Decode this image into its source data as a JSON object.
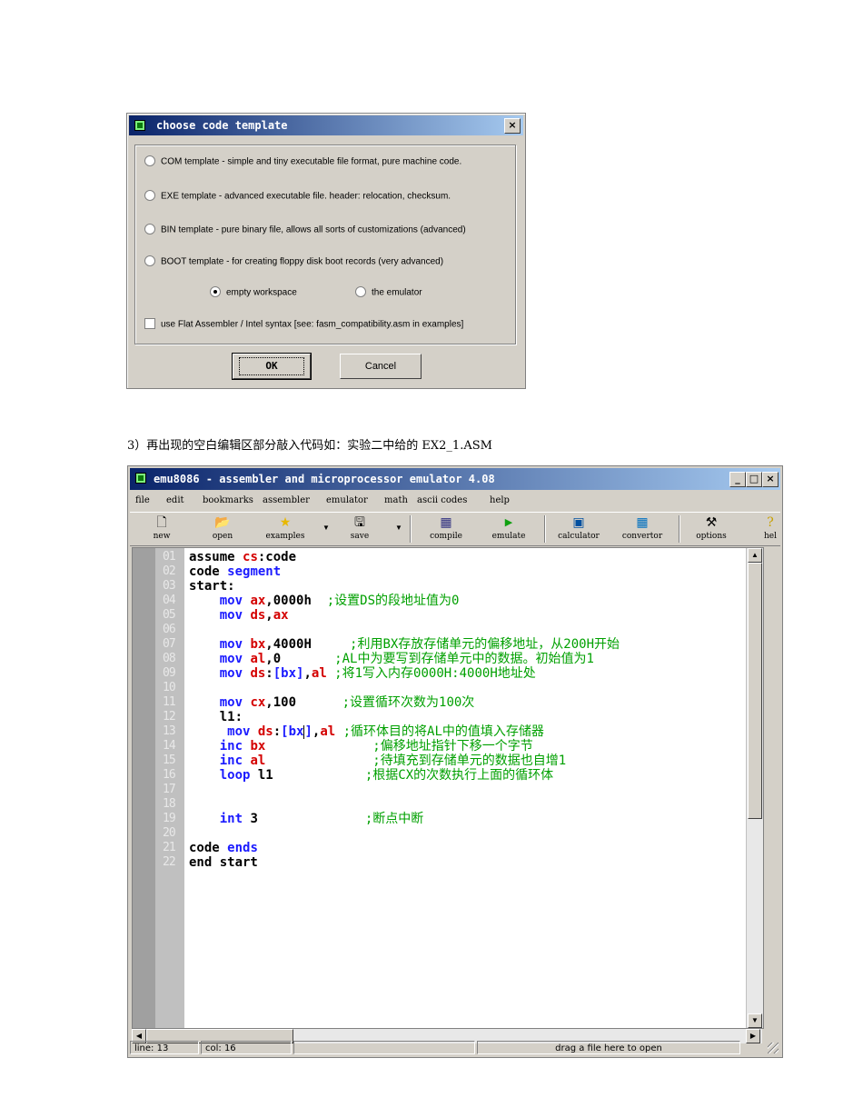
{
  "dialog": {
    "title": "choose code template",
    "close_label": "×",
    "options": [
      "COM template - simple and tiny executable file format, pure machine code.",
      "EXE template - advanced executable file. header: relocation, checksum.",
      "BIN template - pure binary file, allows all sorts of customizations (advanced)",
      "BOOT template - for creating floppy disk boot records (very advanced)"
    ],
    "empty_workspace": "empty workspace",
    "the_emulator": "the emulator",
    "flat_assembler": "use Flat Assembler / Intel syntax   [see: fasm_compatibility.asm in examples]",
    "ok_label": "OK",
    "cancel_label": "Cancel"
  },
  "caption": "3）再出现的空白编辑区部分敲入代码如：实验二中给的 EX2_1.ASM",
  "emu": {
    "title": "emu8086 - assembler and microprocessor emulator 4.08",
    "minimize": "_",
    "maximize": "□",
    "close": "×",
    "menu": [
      "file",
      "edit",
      "bookmarks",
      "assembler",
      "emulator",
      "math",
      "ascii codes",
      "help"
    ],
    "toolbar": {
      "new": "new",
      "open": "open",
      "examples": "examples",
      "save": "save",
      "compile": "compile",
      "emulate": "emulate",
      "calculator": "calculator",
      "convertor": "convertor",
      "options": "options",
      "help": "hel"
    },
    "line_numbers": [
      "01",
      "02",
      "03",
      "04",
      "05",
      "06",
      "07",
      "08",
      "09",
      "10",
      "11",
      "12",
      "13",
      "14",
      "15",
      "16",
      "17",
      "18",
      "19",
      "20",
      "21",
      "22"
    ],
    "code": {
      "l01a": "assume ",
      "l01b": "cs",
      "l01c": ":code",
      "l02a": "code ",
      "l02b": "segment",
      "l03": "start:",
      "l04a": "    mov ",
      "l04b": "ax",
      "l04c": ",0000h  ",
      "l04d": ";设置DS的段地址值为0",
      "l05a": "    mov ",
      "l05b": "ds",
      "l05c": ",",
      "l05d": "ax",
      "l07a": "    mov ",
      "l07b": "bx",
      "l07c": ",4000H     ",
      "l07d": ";利用BX存放存储单元的偏移地址，从200H开始",
      "l08a": "    mov ",
      "l08b": "al",
      "l08c": ",0       ",
      "l08d": ";AL中为要写到存储单元中的数据。初始值为1",
      "l09a": "    mov ",
      "l09b": "ds",
      "l09c": ":",
      "l09d": "[bx]",
      "l09e": ",",
      "l09f": "al",
      "l09g": " ;将1写入内存0000H:4000H地址处",
      "l11a": "    mov ",
      "l11b": "cx",
      "l11c": ",100      ",
      "l11d": ";设置循环次数为100次",
      "l12": "    l1:",
      "l13a": "     mov ",
      "l13b": "ds",
      "l13c": ":",
      "l13d": "[bx",
      "l13e": "]",
      "l13f": ",",
      "l13g": "al",
      "l13h": " ;循环体目的将AL中的值填入存储器",
      "l14a": "    inc ",
      "l14b": "bx",
      "l14c": "              ;偏移地址指针下移一个字节",
      "l15a": "    inc ",
      "l15b": "al",
      "l15c": "              ;待填充到存储单元的数据也自增1",
      "l16a": "    loop ",
      "l16b": "l1",
      "l16c": "            ;根据CX的次数执行上面的循环体",
      "l19a": "    int ",
      "l19b": "3",
      "l19c": "              ;断点中断",
      "l21a": "code ",
      "l21b": "ends",
      "l22a": "end ",
      "l22b": "start"
    },
    "status": {
      "line": "line: 13",
      "col": "col: 16",
      "hint": "drag a file here to open"
    }
  }
}
